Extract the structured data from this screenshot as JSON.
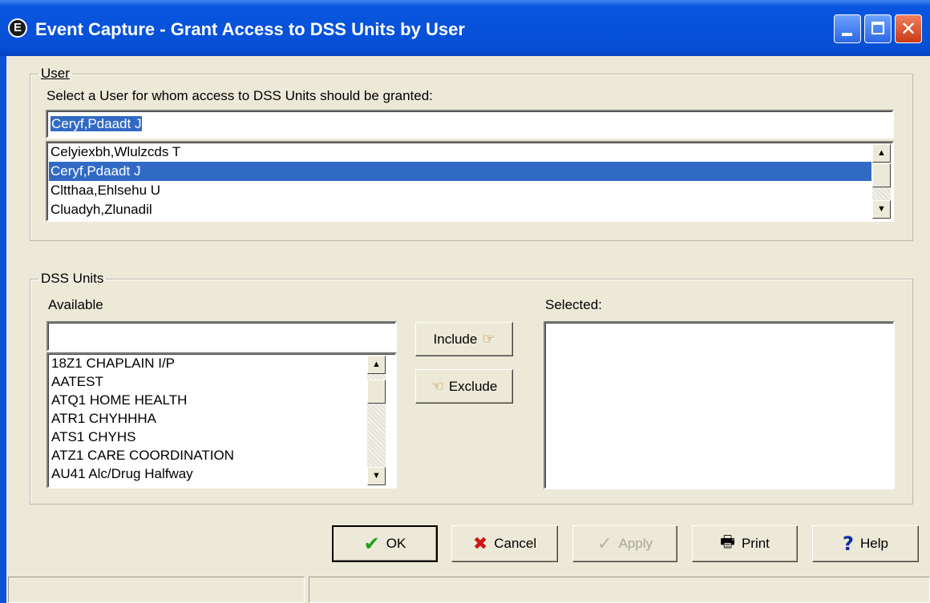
{
  "window": {
    "title": "Event Capture - Grant Access to DSS Units by User",
    "app_icon_glyph": "E"
  },
  "user_group": {
    "legend": "User",
    "instruction": "Select a User for whom access to DSS Units should be granted:",
    "search_value": "Ceryf,Pdaadt J",
    "list_items": [
      "Celyiexbh,Wlulzcds T",
      "Ceryf,Pdaadt J",
      "Cltthaa,Ehlsehu U",
      "Cluadyh,Zlunadil"
    ],
    "selected_index": 1
  },
  "dss_group": {
    "legend": "DSS Units",
    "available_label": "Available",
    "selected_label": "Selected:",
    "available_search_value": "",
    "available_items": [
      "18Z1 CHAPLAIN I/P",
      "AATEST",
      "ATQ1 HOME HEALTH",
      "ATR1 CHYHHHA",
      "ATS1 CHYHS",
      "ATZ1 CARE COORDINATION",
      "AU41 Alc/Drug Halfway"
    ],
    "selected_items": [],
    "include_label": "Include",
    "exclude_label": "Exclude"
  },
  "buttons": {
    "ok": "OK",
    "cancel": "Cancel",
    "apply": "Apply",
    "print": "Print",
    "help": "Help"
  },
  "icons": {
    "ok": "checkmark-icon",
    "cancel": "x-icon",
    "apply": "checkmark-outline-icon",
    "print": "printer-icon",
    "help": "question-mark-icon",
    "include": "pointing-hand-right-icon",
    "exclude": "pointing-hand-left-icon"
  },
  "colors": {
    "title_bar": "#0650d6",
    "selection": "#316ac5",
    "dialog_background": "#ece9d8",
    "ok_check": "#1e9e1e",
    "cancel_x": "#d21414"
  }
}
